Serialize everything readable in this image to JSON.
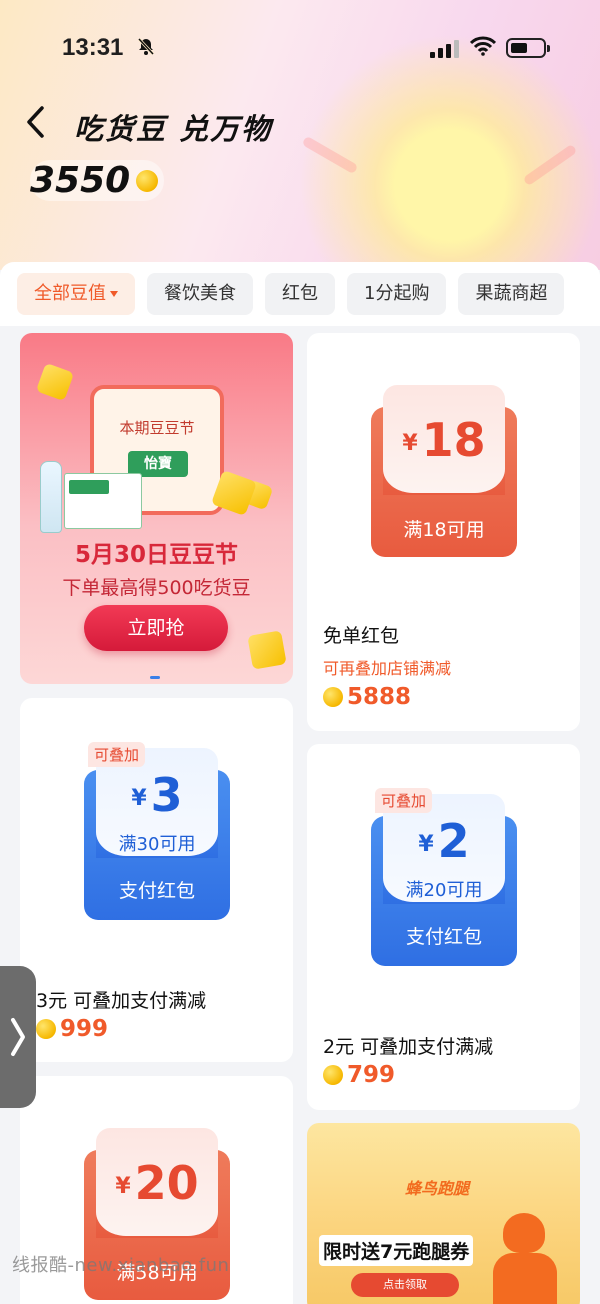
{
  "status_bar": {
    "time": "13:31",
    "bell_icon": "bell-slash-icon"
  },
  "header": {
    "back_icon": "chevron-left-icon",
    "title": "吃货豆 兑万物",
    "balance": "3550"
  },
  "tabs": [
    {
      "label": "全部豆值",
      "active": true
    },
    {
      "label": "餐饮美食"
    },
    {
      "label": "红包"
    },
    {
      "label": "1分起购"
    },
    {
      "label": "果蔬商超"
    }
  ],
  "banner": {
    "calendar_title": "本期豆豆节",
    "brand_logo": "怡寶",
    "headline": "5月30日豆豆节",
    "subline": "下单最高得500吃货豆",
    "cta": "立即抢"
  },
  "items": [
    {
      "currency": "¥",
      "amount": "18",
      "voucher_label": "满18可用",
      "name": "免单红包",
      "note": "可再叠加店铺满减",
      "price": "5888",
      "theme": "red"
    },
    {
      "tag": "可叠加",
      "currency": "¥",
      "amount": "3",
      "condition": "满30可用",
      "voucher_label": "支付红包",
      "name": "3元 可叠加支付满减",
      "price": "999",
      "theme": "blue"
    },
    {
      "tag": "可叠加",
      "currency": "¥",
      "amount": "2",
      "condition": "满20可用",
      "voucher_label": "支付红包",
      "name": "2元 可叠加支付满减",
      "price": "799",
      "theme": "blue"
    },
    {
      "currency": "¥",
      "amount": "20",
      "voucher_label": "满58可用",
      "theme": "red"
    }
  ],
  "promo": {
    "brand": "蜂鸟跑腿",
    "headline": "限时送7元跑腿券",
    "button": "点击领取"
  },
  "side_handle_icon": "chevron-right-icon",
  "watermark": "线报酷-new.xianbao.fun",
  "colors": {
    "accent": "#f05a2a",
    "voucher_red": "#e85b3f",
    "voucher_blue": "#2f6fe3"
  }
}
